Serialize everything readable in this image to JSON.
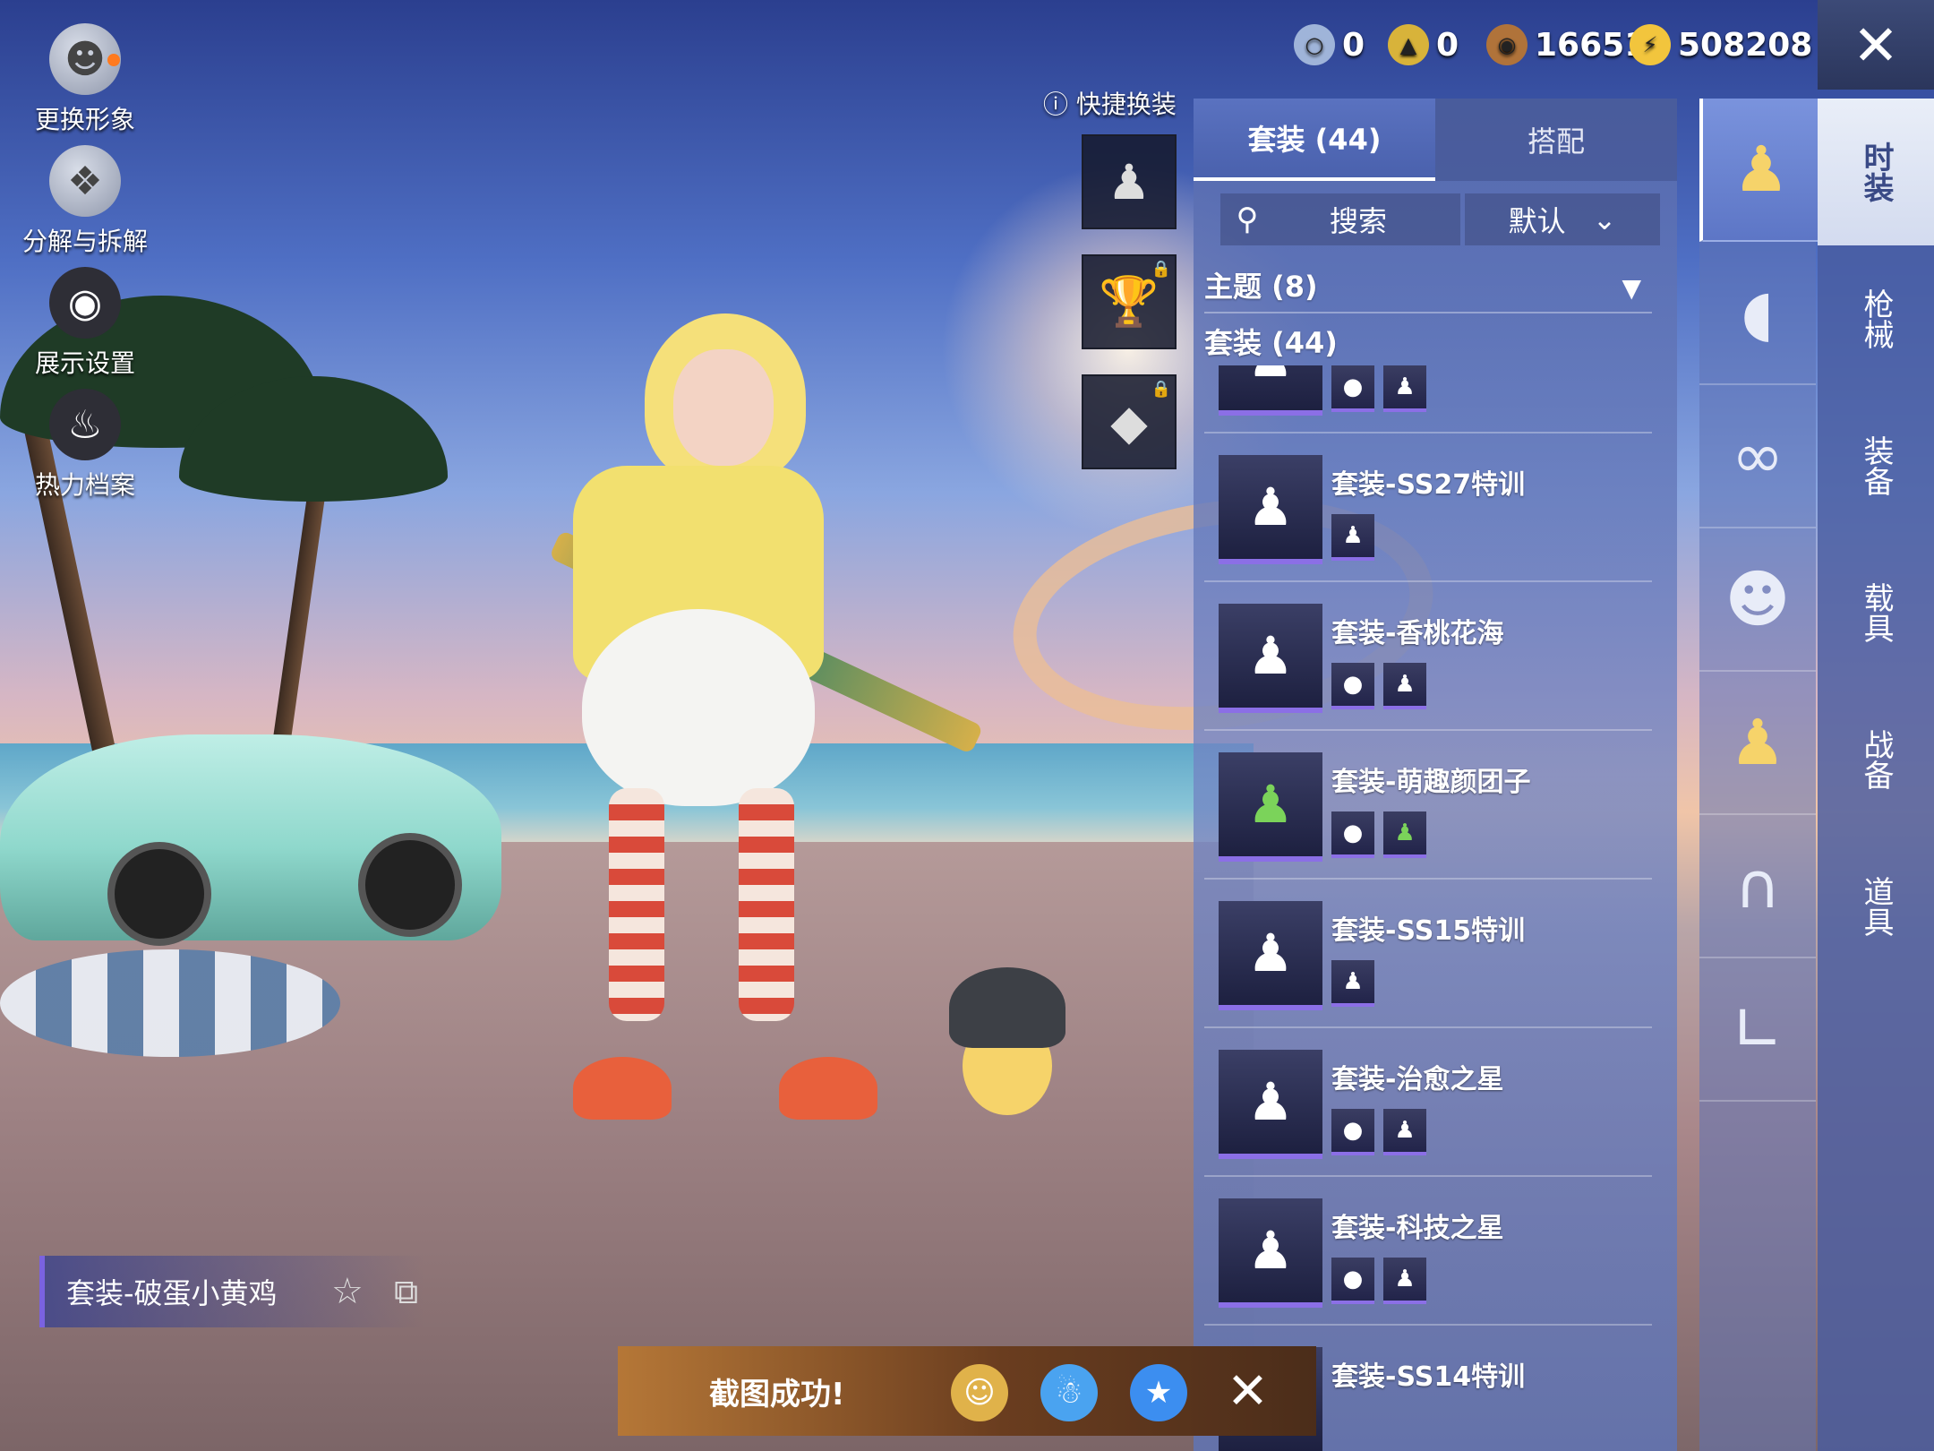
{
  "left_menu": [
    {
      "label": "更换形象",
      "icon": "avatar-icon"
    },
    {
      "label": "分解与拆解",
      "icon": "puzzle-icon"
    },
    {
      "label": "展示设置",
      "icon": "eye-icon"
    },
    {
      "label": "热力档案",
      "icon": "flame-icon"
    }
  ],
  "currencies": [
    {
      "icon": "token-coin-icon",
      "value": "0",
      "color": "#9fb4d9"
    },
    {
      "icon": "gold-badge-icon",
      "value": "0",
      "color": "#d8b33a"
    },
    {
      "icon": "bronze-coin-icon",
      "value": "16651",
      "color": "#b0733a"
    },
    {
      "icon": "lightning-coin-icon",
      "value": "508208",
      "color": "#f2c53d"
    }
  ],
  "quick_change": {
    "label": "快捷换装"
  },
  "panel": {
    "tabs": [
      "套装 (44)",
      "搭配"
    ],
    "search_label": "搜索",
    "sort_label": "默认",
    "section_theme": "主题 (8)",
    "section_outfits": "套装 (44)"
  },
  "items": [
    {
      "name": "套装-SS27特训",
      "subs": 1
    },
    {
      "name": "套装-香桃花海",
      "subs": 2
    },
    {
      "name": "套装-萌趣颜团子",
      "subs": 2
    },
    {
      "name": "套装-SS15特训",
      "subs": 1
    },
    {
      "name": "套装-治愈之星",
      "subs": 2
    },
    {
      "name": "套装-科技之星",
      "subs": 2
    },
    {
      "name": "套装-SS14特训",
      "subs": 0
    }
  ],
  "categories": [
    "chick-outfit-icon",
    "cap-icon",
    "glasses-icon",
    "mask-icon",
    "chick-outfit-icon",
    "pants-icon",
    "boots-icon"
  ],
  "right_tabs": [
    "时装",
    "枪械",
    "装备",
    "载具",
    "战备",
    "道具"
  ],
  "outfit_name": "套装-破蛋小黄鸡",
  "toast": {
    "message": "截图成功!"
  }
}
